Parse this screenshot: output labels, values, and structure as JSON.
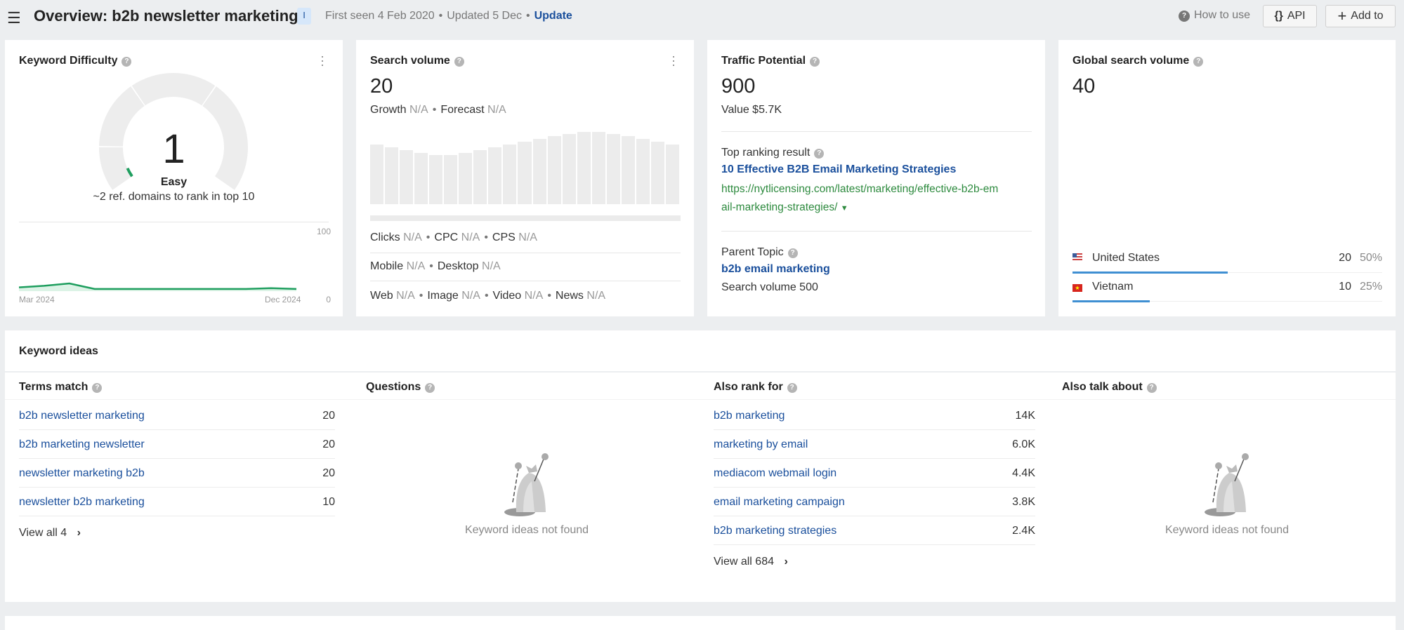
{
  "header": {
    "title": "Overview: b2b newsletter marketing",
    "badge": "I",
    "first_seen": "First seen 4 Feb 2020",
    "updated": "Updated 5 Dec",
    "update_link": "Update",
    "how_to_use": "How to use",
    "api": "API",
    "add_to": "Add to"
  },
  "kd": {
    "title": "Keyword Difficulty",
    "value": "1",
    "label": "Easy",
    "subtitle": "~2 ref. domains to rank in top 10",
    "score": 1,
    "trend": {
      "y_max": "100",
      "y_min": "0",
      "x_start": "Mar 2024",
      "x_end": "Dec 2024",
      "values": [
        3,
        5,
        8,
        1,
        1,
        1,
        1,
        1,
        1,
        1,
        2,
        1
      ]
    },
    "accent": "#1e9e5e"
  },
  "sv": {
    "title": "Search volume",
    "value": "20",
    "growth_label": "Growth",
    "growth": "N/A",
    "forecast_label": "Forecast",
    "forecast": "N/A",
    "clicks_label": "Clicks",
    "clicks": "N/A",
    "cpc_label": "CPC",
    "cpc": "N/A",
    "cps_label": "CPS",
    "cps": "N/A",
    "mobile_label": "Mobile",
    "mobile": "N/A",
    "desktop_label": "Desktop",
    "desktop": "N/A",
    "web_label": "Web",
    "web": "N/A",
    "image_label": "Image",
    "image": "N/A",
    "video_label": "Video",
    "video": "N/A",
    "news_label": "News",
    "news": "N/A"
  },
  "tp": {
    "title": "Traffic Potential",
    "value": "900",
    "value_text": "Value $5.7K",
    "top_label": "Top ranking result",
    "top_title": "10 Effective B2B Email Marketing Strategies",
    "top_url_1": "https://nytlicensing.com/latest/marketing/effective-b2b-em",
    "top_url_2": "ail-marketing-strategies/",
    "parent_label": "Parent Topic",
    "parent_link": "b2b email marketing",
    "parent_volume": "Search volume 500"
  },
  "gsv": {
    "title": "Global search volume",
    "value": "40",
    "countries": [
      {
        "name": "United States",
        "volume": "20",
        "pct": "50%",
        "share": 50
      },
      {
        "name": "Vietnam",
        "volume": "10",
        "pct": "25%",
        "share": 25
      }
    ]
  },
  "ideas": {
    "title": "Keyword ideas",
    "empty_text": "Keyword ideas not found",
    "terms": {
      "title": "Terms match",
      "rows": [
        {
          "k": "b2b newsletter marketing",
          "v": "20"
        },
        {
          "k": "b2b marketing newsletter",
          "v": "20"
        },
        {
          "k": "newsletter marketing b2b",
          "v": "20"
        },
        {
          "k": "newsletter b2b marketing",
          "v": "10"
        }
      ],
      "view_all": "View all 4"
    },
    "questions": {
      "title": "Questions"
    },
    "also_rank": {
      "title": "Also rank for",
      "rows": [
        {
          "k": "b2b marketing",
          "v": "14K"
        },
        {
          "k": "marketing by email",
          "v": "6.0K"
        },
        {
          "k": "mediacom webmail login",
          "v": "4.4K"
        },
        {
          "k": "email marketing campaign",
          "v": "3.8K"
        },
        {
          "k": "b2b marketing strategies",
          "v": "2.4K"
        }
      ],
      "view_all": "View all 684"
    },
    "also_talk": {
      "title": "Also talk about"
    }
  }
}
